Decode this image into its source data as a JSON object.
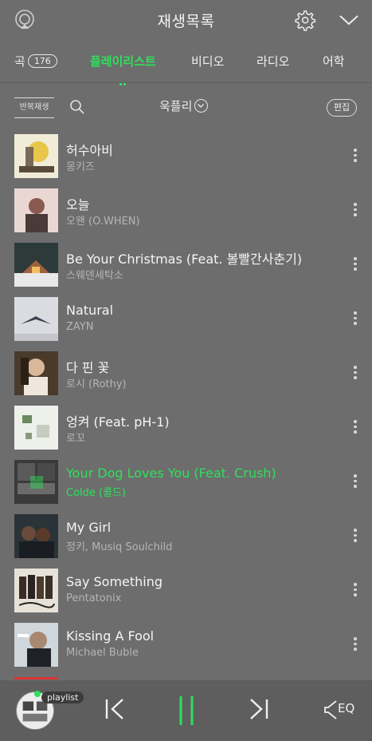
{
  "header": {
    "title": "재생목록"
  },
  "tabs": [
    {
      "label": "곡",
      "badge": "176"
    },
    {
      "label": "플레이리스트"
    },
    {
      "label": "비디오"
    },
    {
      "label": "라디오"
    },
    {
      "label": "어학"
    }
  ],
  "toolbar": {
    "repeat_label": "반복재생",
    "playlist_name": "욱플리",
    "edit_label": "편집"
  },
  "songs": [
    {
      "title": "허수아비",
      "artist": "몽키즈",
      "playing": false
    },
    {
      "title": "오늘",
      "artist": "오왠 (O.WHEN)",
      "playing": false
    },
    {
      "title": "Be Your Christmas (Feat. 볼빨간사춘기)",
      "artist": "스웨덴세탁소",
      "playing": false
    },
    {
      "title": "Natural",
      "artist": "ZAYN",
      "playing": false
    },
    {
      "title": "다 핀 꽃",
      "artist": "로시 (Rothy)",
      "playing": false
    },
    {
      "title": "엉켜 (Feat. pH-1)",
      "artist": "로꼬",
      "playing": false
    },
    {
      "title": "Your Dog Loves You (Feat. Crush)",
      "artist": "Colde (콜드)",
      "playing": true
    },
    {
      "title": "My Girl",
      "artist": "정키, Musiq Soulchild",
      "playing": false
    },
    {
      "title": "Say Something",
      "artist": "Pentatonix",
      "playing": false
    },
    {
      "title": "Kissing A Fool",
      "artist": "Michael Buble",
      "playing": false
    }
  ],
  "player": {
    "chip_label": "playlist",
    "eq_label": "EQ"
  },
  "colors": {
    "accent": "#2ee05c",
    "background": "#6d6d6d"
  }
}
